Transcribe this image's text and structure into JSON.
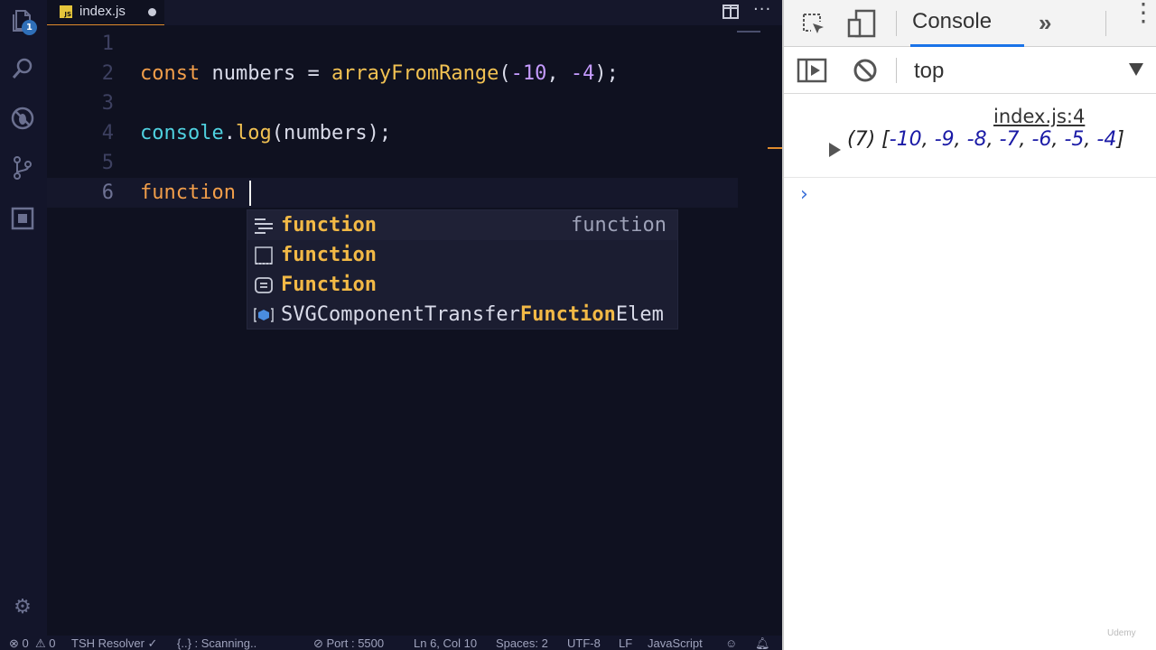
{
  "activity": {
    "explorer_badge": "1"
  },
  "tab": {
    "filename": "index.js",
    "js_badge": "JS"
  },
  "editor": {
    "line_numbers": [
      "1",
      "2",
      "3",
      "4",
      "5",
      "6"
    ],
    "line2": {
      "kw": "const",
      "name": " numbers = ",
      "fn": "arrayFromRange",
      "open": "(",
      "n1": "-10",
      "comma": ", ",
      "n2": "-4",
      "close": ");"
    },
    "line4": {
      "obj": "console",
      "dot": ".",
      "fn": "log",
      "rest": "(numbers);"
    },
    "line6": {
      "text": "function "
    }
  },
  "suggestions": [
    {
      "icon": "snippet-icon",
      "label": "function",
      "detail": "function"
    },
    {
      "icon": "keyword-icon",
      "label": "function",
      "detail": ""
    },
    {
      "icon": "interface-icon",
      "label": "Function",
      "detail": ""
    },
    {
      "icon": "class-icon",
      "label_pre": "SVGComponentTransfer",
      "label_match": "Function",
      "label_post": "Elem",
      "detail": ""
    }
  ],
  "status_bar": {
    "errors": "0",
    "warnings": "0",
    "resolver": "TSH Resolver",
    "scanning": "{..} : Scanning..",
    "port": "Port : 5500",
    "position": "Ln 6, Col 10",
    "spaces": "Spaces: 2",
    "encoding": "UTF-8",
    "eol": "LF",
    "language": "JavaScript"
  },
  "devtools": {
    "tab_console": "Console",
    "context": "top",
    "log_source": "index.js:4",
    "log_count": "(7)",
    "log_values": [
      "-10",
      "-9",
      "-8",
      "-7",
      "-6",
      "-5",
      "-4"
    ],
    "prompt": "›"
  },
  "watermark": "Udemy",
  "colors": {
    "accent_orange": "#e08b2c",
    "keyword": "#f19e4a",
    "function": "#f1c152",
    "number": "#c59bff",
    "object": "#4fd1e0",
    "devtools_blue": "#1a73e8"
  }
}
